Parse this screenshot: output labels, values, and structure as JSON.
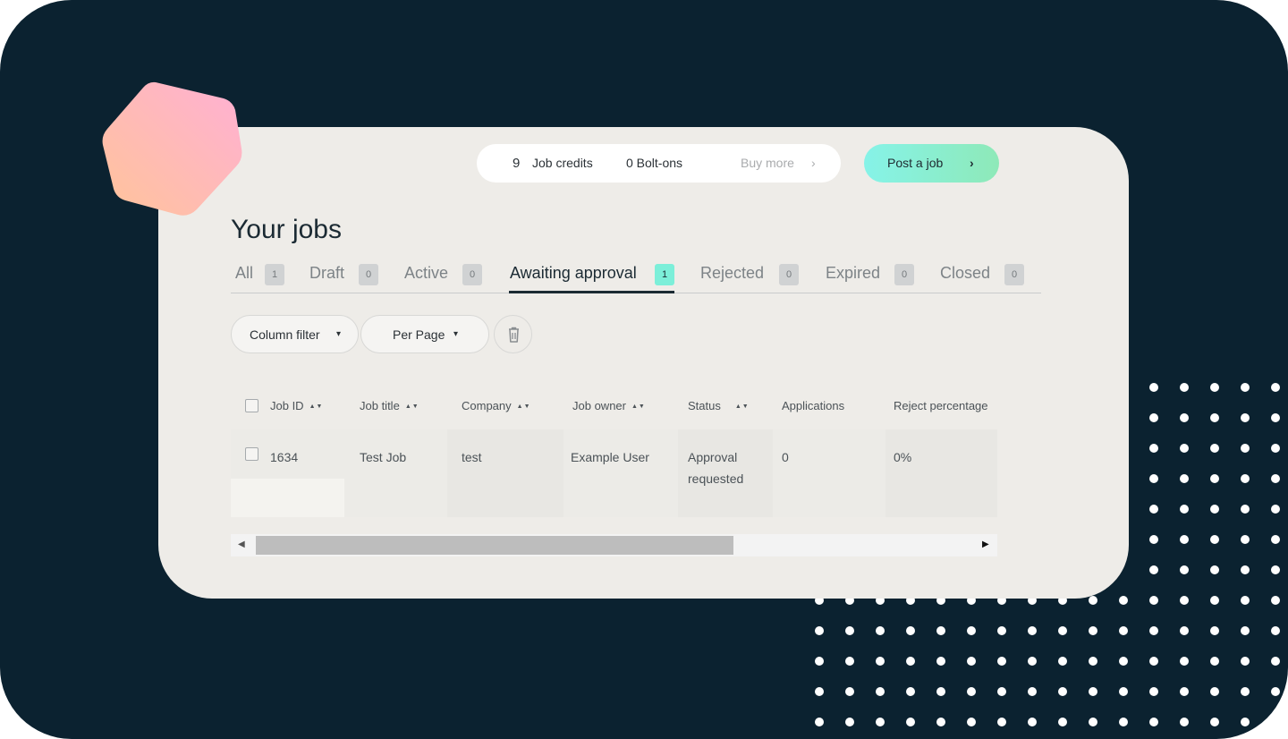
{
  "header": {
    "job_credits_count": "9",
    "job_credits_label": "Job credits",
    "bolt_ons": "0 Bolt-ons",
    "buy_more": "Buy more",
    "buy_more_chevron": "›",
    "post_job_label": "Post a job",
    "post_job_chevron": "›"
  },
  "page": {
    "title": "Your jobs"
  },
  "tabs": [
    {
      "label": "All",
      "count": "1"
    },
    {
      "label": "Draft",
      "count": "0"
    },
    {
      "label": "Active",
      "count": "0"
    },
    {
      "label": "Awaiting approval",
      "count": "1",
      "selected": true
    },
    {
      "label": "Rejected",
      "count": "0"
    },
    {
      "label": "Expired",
      "count": "0"
    },
    {
      "label": "Closed",
      "count": "0"
    }
  ],
  "toolbar": {
    "column_filter": "Column filter",
    "per_page": "Per Page",
    "dropdown_caret": "▾",
    "trash_icon": "trash-icon"
  },
  "table": {
    "sort_icon": "▲▼",
    "headers": [
      "Job ID",
      "Job title",
      "Company",
      "Job owner",
      "Status",
      "Applications",
      "Reject percentage"
    ],
    "rows": [
      {
        "job_id": "1634",
        "job_title": "Test Job",
        "company": "test",
        "job_owner": "Example User",
        "status_line1": "Approval",
        "status_line2": "requested",
        "applications": "0",
        "reject_percentage": "0%"
      }
    ]
  },
  "scrollbar": {
    "left_arrow": "◀",
    "right_arrow": "▶",
    "thumb_fraction": 0.62
  },
  "colors": {
    "background": "#0b2230",
    "card": "#eeece8",
    "accent_gradient_start": "#86f3e8",
    "accent_gradient_end": "#8ee9b8",
    "hexagon_start": "#ffc49a",
    "hexagon_end": "#ffb0d4"
  }
}
